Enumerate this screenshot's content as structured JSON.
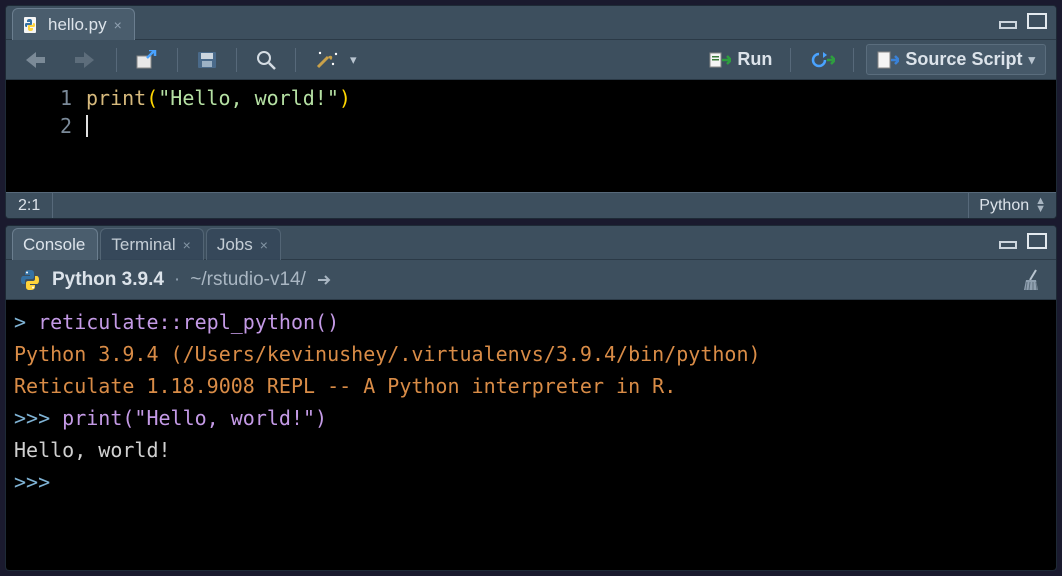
{
  "editor": {
    "tab": {
      "filename": "hello.py"
    },
    "toolbar": {
      "run": "Run",
      "source": "Source Script"
    },
    "lines": [
      {
        "n": "1",
        "html": "print(\"Hello, world!\")"
      },
      {
        "n": "2",
        "html": ""
      }
    ],
    "status": {
      "pos": "2:1",
      "lang": "Python"
    }
  },
  "console": {
    "tabs": {
      "console": "Console",
      "terminal": "Terminal",
      "jobs": "Jobs"
    },
    "env": {
      "version": "Python 3.9.4",
      "path": "~/rstudio-v14/"
    },
    "lines": [
      {
        "cls": "cmd",
        "prompt": "> ",
        "text": "reticulate::repl_python()"
      },
      {
        "cls": "info",
        "prompt": "",
        "text": "Python 3.9.4 (/Users/kevinushey/.virtualenvs/3.9.4/bin/python)"
      },
      {
        "cls": "info",
        "prompt": "",
        "text": "Reticulate 1.18.9008 REPL -- A Python interpreter in R."
      },
      {
        "cls": "cmd",
        "prompt": ">>> ",
        "text": "print(\"Hello, world!\")"
      },
      {
        "cls": "out",
        "prompt": "",
        "text": "Hello, world!"
      },
      {
        "cls": "cmd",
        "prompt": ">>> ",
        "text": ""
      }
    ]
  }
}
